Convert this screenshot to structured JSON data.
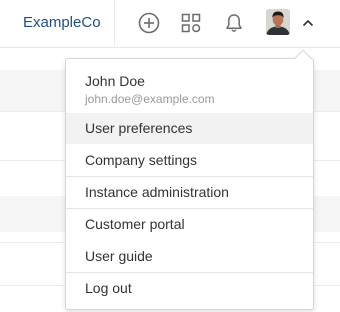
{
  "header": {
    "brand": "ExampleCo",
    "icons": [
      "add-circle-icon",
      "apps-grid-icon",
      "bell-icon",
      "chevron-up-icon"
    ],
    "colors": {
      "brand": "#1e4f8e",
      "icon": "#6b6b6b"
    }
  },
  "user_menu": {
    "name": "John Doe",
    "email": "john.doe@example.com",
    "items": [
      "User preferences",
      "Company settings",
      "Instance administration",
      "Customer portal",
      "User guide",
      "Log out"
    ],
    "highlighted_item": "User preferences",
    "colors": {
      "highlight": "#f2f2f2"
    }
  }
}
